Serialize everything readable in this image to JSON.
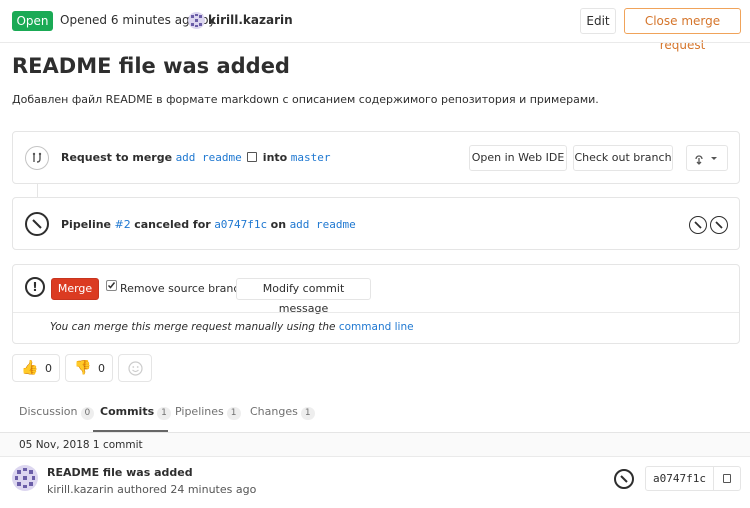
{
  "header": {
    "status": "Open",
    "opened_text": "Opened 6 minutes ago by",
    "author": "kirill.kazarin",
    "edit_label": "Edit",
    "close_label": "Close merge request"
  },
  "title": "README file was added",
  "description": "Добавлен файл README в формате markdown с описанием содержимого репозитория и примерами.",
  "merge_request": {
    "label": "Request to merge",
    "source_branch": "add readme",
    "into_label": "into",
    "target_branch": "master",
    "web_ide_label": "Open in Web IDE",
    "checkout_label": "Check out branch"
  },
  "pipeline": {
    "label": "Pipeline",
    "id": "#2",
    "status_text": "canceled for",
    "commit": "a0747f1c",
    "on_label": "on",
    "branch": "add readme"
  },
  "merge_widget": {
    "merge_label": "Merge",
    "remove_source_label": "Remove source branch",
    "modify_commit_label": "Modify commit message",
    "manual_text": "You can merge this merge request manually using the",
    "command_line_link": "command line"
  },
  "reactions": {
    "thumbs_up_count": "0",
    "thumbs_down_count": "0"
  },
  "tabs": [
    {
      "label": "Discussion",
      "count": "0"
    },
    {
      "label": "Commits",
      "count": "1"
    },
    {
      "label": "Pipelines",
      "count": "1"
    },
    {
      "label": "Changes",
      "count": "1"
    }
  ],
  "commits": {
    "date_header": "05 Nov, 2018 1 commit",
    "items": [
      {
        "title": "README file was added",
        "author_line": "kirill.kazarin authored 24 minutes ago",
        "sha": "a0747f1c"
      }
    ]
  },
  "colors": {
    "open_green": "#1aaa55",
    "merge_red": "#db3b21",
    "link_blue": "#1f78d1",
    "close_orange": "#d5752b"
  }
}
